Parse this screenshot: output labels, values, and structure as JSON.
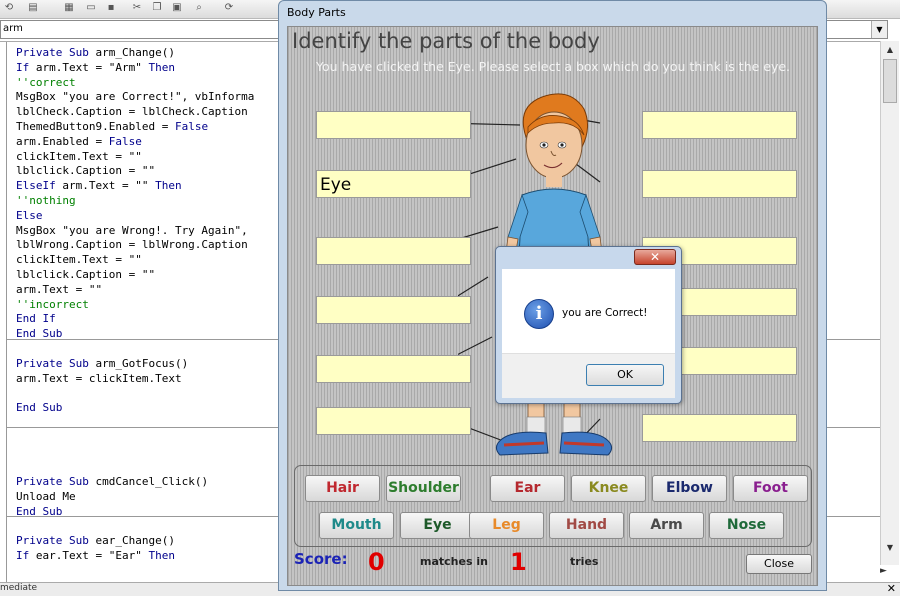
{
  "ide": {
    "object_combo": "arm",
    "code_blocks": [
      [
        [
          [
            "kw",
            "Private Sub "
          ],
          [
            "t",
            "arm_Change()"
          ]
        ],
        [
          [
            "kw",
            "If "
          ],
          [
            "t",
            "arm.Text = \"Arm\" "
          ],
          [
            "kw",
            "Then"
          ]
        ],
        [
          [
            "cm",
            "''correct"
          ]
        ],
        [
          [
            "t",
            "MsgBox \"you are Correct!\", vbInforma"
          ]
        ],
        [
          [
            "t",
            "lblCheck.Caption = lblCheck.Caption"
          ]
        ],
        [
          [
            "t",
            "ThemedButton9.Enabled = "
          ],
          [
            "kw",
            "False"
          ]
        ],
        [
          [
            "t",
            "arm.Enabled = "
          ],
          [
            "kw",
            "False"
          ]
        ],
        [
          [
            "t",
            "clickItem.Text = \"\""
          ]
        ],
        [
          [
            "t",
            "lblclick.Caption = \"\""
          ]
        ],
        [
          [
            "kw",
            "ElseIf "
          ],
          [
            "t",
            "arm.Text = \"\" "
          ],
          [
            "kw",
            "Then"
          ]
        ],
        [
          [
            "cm",
            "''nothing"
          ]
        ],
        [
          [
            "kw",
            "Else"
          ]
        ],
        [
          [
            "t",
            "MsgBox \"you are Wrong!. Try Again\","
          ]
        ],
        [
          [
            "t",
            "lblWrong.Caption = lblWrong.Caption"
          ]
        ],
        [
          [
            "t",
            "clickItem.Text = \"\""
          ]
        ],
        [
          [
            "t",
            "lblclick.Caption = \"\""
          ]
        ],
        [
          [
            "t",
            "arm.Text = \"\""
          ]
        ],
        [
          [
            "cm",
            "''incorrect"
          ]
        ],
        [
          [
            "kw",
            "End If"
          ]
        ],
        [
          [
            "kw",
            "End Sub"
          ]
        ]
      ],
      [
        [
          [
            "t",
            ""
          ]
        ],
        [
          [
            "kw",
            "Private Sub "
          ],
          [
            "t",
            "arm_GotFocus()"
          ]
        ],
        [
          [
            "t",
            "arm.Text = clickItem.Text"
          ]
        ],
        [
          [
            "t",
            ""
          ]
        ],
        [
          [
            "kw",
            "End Sub"
          ]
        ]
      ],
      [
        [
          [
            "t",
            ""
          ]
        ],
        [
          [
            "t",
            ""
          ]
        ],
        [
          [
            "t",
            ""
          ]
        ],
        [
          [
            "t",
            ""
          ]
        ],
        [
          [
            "kw",
            "Private Sub "
          ],
          [
            "t",
            "cmdCancel_Click()"
          ]
        ],
        [
          [
            "t",
            "Unload Me"
          ]
        ],
        [
          [
            "kw",
            "End Sub"
          ]
        ]
      ],
      [
        [
          [
            "t",
            ""
          ]
        ],
        [
          [
            "kw",
            "Private Sub "
          ],
          [
            "t",
            "ear_Change()"
          ]
        ],
        [
          [
            "kw",
            "If "
          ],
          [
            "t",
            "ear.Text = \"Ear\" "
          ],
          [
            "kw",
            "Then"
          ]
        ]
      ]
    ],
    "immediate_label": "mediate"
  },
  "window": {
    "title": "Body Parts",
    "heading": "Identify the parts of the body",
    "instruction": "You have clicked the Eye. Please select a box which do you think is the eye.",
    "left_boxes": [
      "",
      "Eye",
      "",
      "",
      "",
      ""
    ],
    "right_boxes": [
      "",
      "",
      "",
      "",
      "",
      "",
      ""
    ],
    "buttons": [
      {
        "label": "Hair",
        "color": "#c0282f"
      },
      {
        "label": "Shoulder",
        "color": "#2e7d2e"
      },
      {
        "label": "Ear",
        "color": "#b5282e"
      },
      {
        "label": "Knee",
        "color": "#8a8a20"
      },
      {
        "label": "Elbow",
        "color": "#1b2a6e"
      },
      {
        "label": "Foot",
        "color": "#8a1f8f"
      },
      {
        "label": "Mouth",
        "color": "#1f8a8a"
      },
      {
        "label": "Eye",
        "color": "#1e5a2a"
      },
      {
        "label": "Leg",
        "color": "#e88a2a"
      },
      {
        "label": "Hand",
        "color": "#a14a45"
      },
      {
        "label": "Arm",
        "color": "#4a4a4a"
      },
      {
        "label": "Nose",
        "color": "#1f6a3a"
      }
    ],
    "score_label": "Score:",
    "score_value": "0",
    "matches_label": "matches in",
    "tries_value": "1",
    "tries_label": "tries",
    "close_label": "Close"
  },
  "msgbox": {
    "close_glyph": "✕",
    "icon_glyph": "i",
    "text": "you are Correct!",
    "ok_label": "OK"
  }
}
